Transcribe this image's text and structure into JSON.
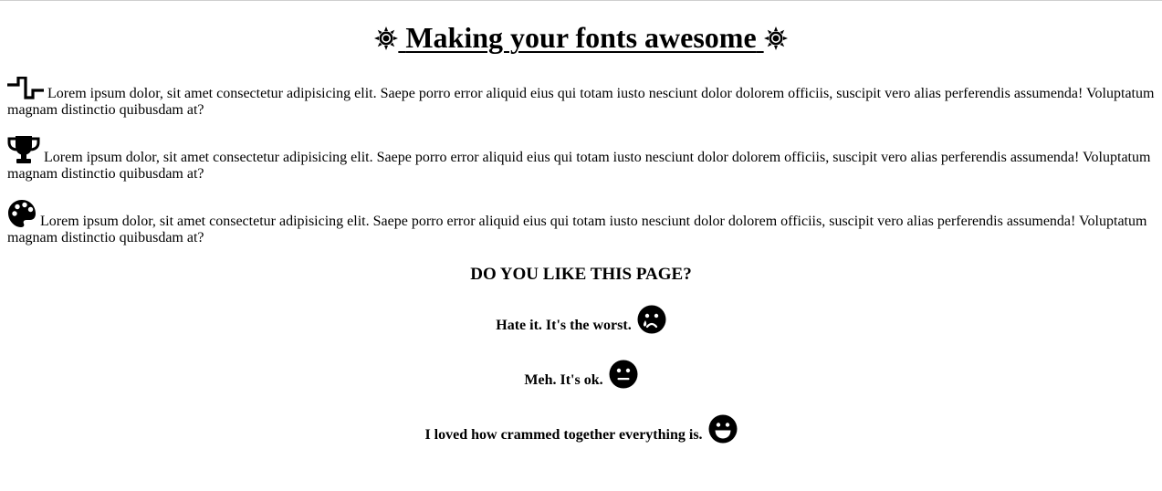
{
  "header": {
    "title": "Making your fonts awesome",
    "left_icon": "sun-icon",
    "right_icon": "sun-icon"
  },
  "paragraphs": [
    {
      "icon": "square-wave-icon",
      "text": "Lorem ipsum dolor, sit amet consectetur adipisicing elit. Saepe porro error aliquid eius qui totam iusto nesciunt dolor dolorem officiis, suscipit vero alias perferendis assumenda! Voluptatum magnam distinctio quibusdam at?"
    },
    {
      "icon": "trophy-icon",
      "text": "Lorem ipsum dolor, sit amet consectetur adipisicing elit. Saepe porro error aliquid eius qui totam iusto nesciunt dolor dolorem officiis, suscipit vero alias perferendis assumenda! Voluptatum magnam distinctio quibusdam at?"
    },
    {
      "icon": "palette-icon",
      "text": "Lorem ipsum dolor, sit amet consectetur adipisicing elit. Saepe porro error aliquid eius qui totam iusto nesciunt dolor dolorem officiis, suscipit vero alias perferendis assumenda! Voluptatum magnam distinctio quibusdam at?"
    }
  ],
  "survey": {
    "question": "DO YOU LIKE THIS PAGE?",
    "answers": [
      {
        "label": "Hate it. It's the worst.",
        "icon": "sad-tear-face-icon"
      },
      {
        "label": "Meh. It's ok.",
        "icon": "neutral-face-icon"
      },
      {
        "label": "I loved how crammed together everything is.",
        "icon": "grin-face-icon"
      }
    ]
  }
}
